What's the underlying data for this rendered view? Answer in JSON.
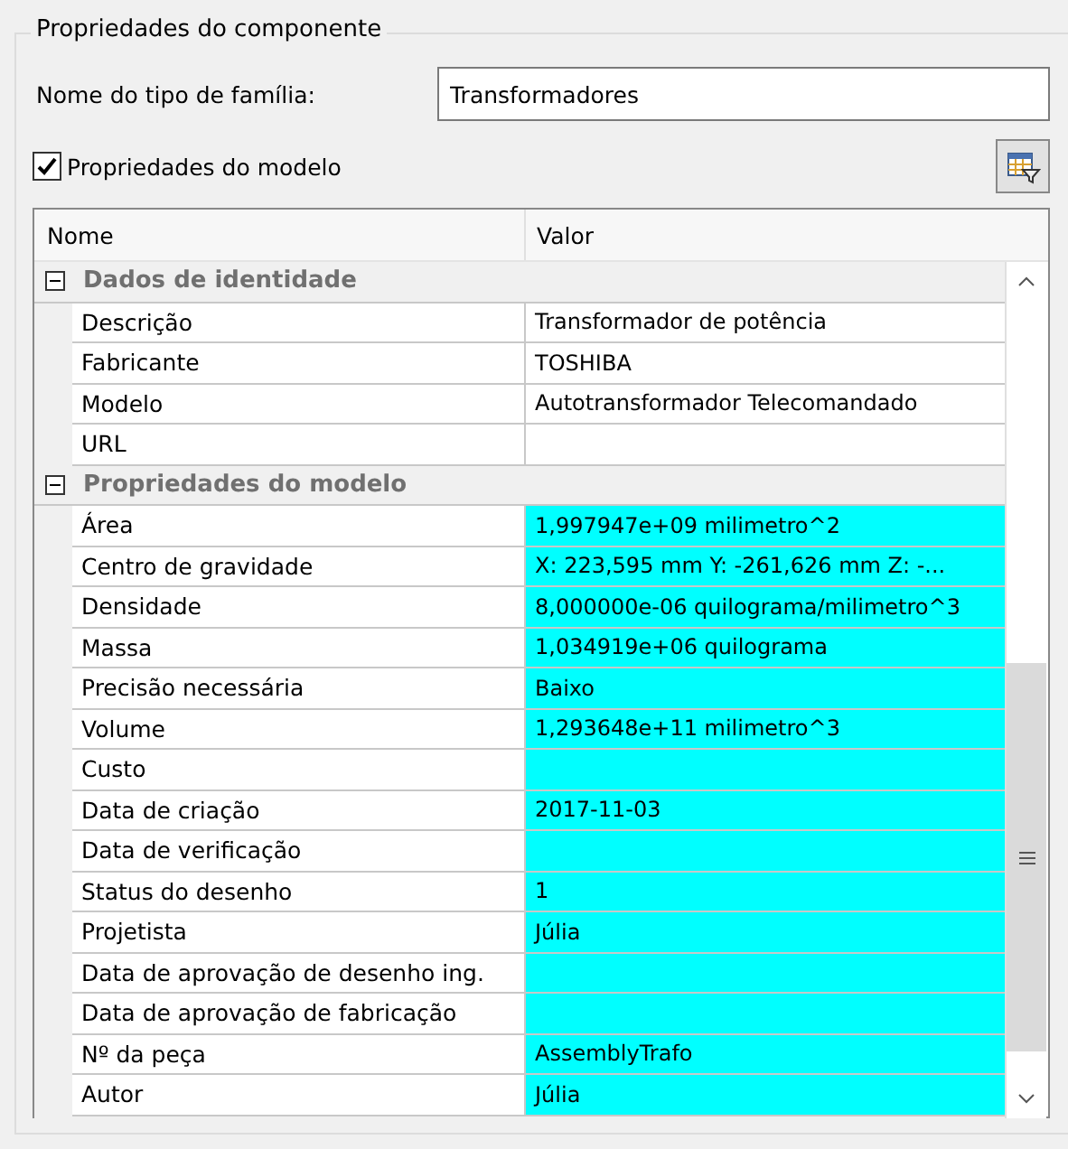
{
  "group_title": "Propriedades do componente",
  "family_label": "Nome do tipo de família:",
  "family_value": "Transformadores",
  "model_checkbox": {
    "label": "Propriedades do modelo",
    "checked": true
  },
  "table": {
    "columns": [
      "Nome",
      "Valor"
    ],
    "sections": [
      {
        "title": "Dados de identidade",
        "expanded": true,
        "rows": [
          {
            "name": "Descrição",
            "value": "Transformador de potência",
            "highlighted": false
          },
          {
            "name": "Fabricante",
            "value": "TOSHIBA",
            "highlighted": false
          },
          {
            "name": "Modelo",
            "value": "Autotransformador Telecomandado",
            "highlighted": false
          },
          {
            "name": "URL",
            "value": "",
            "highlighted": false
          }
        ]
      },
      {
        "title": "Propriedades do modelo",
        "expanded": true,
        "rows": [
          {
            "name": "Área",
            "value": "1,997947e+09 milimetro^2",
            "highlighted": true
          },
          {
            "name": "Centro de gravidade",
            "value": "X: 223,595 mm Y: -261,626 mm Z: -...",
            "highlighted": true
          },
          {
            "name": "Densidade",
            "value": "8,000000e-06 quilograma/milimetro^3",
            "highlighted": true
          },
          {
            "name": "Massa",
            "value": "1,034919e+06 quilograma",
            "highlighted": true
          },
          {
            "name": "Precisão necessária",
            "value": "Baixo",
            "highlighted": true
          },
          {
            "name": "Volume",
            "value": "1,293648e+11 milimetro^3",
            "highlighted": true
          },
          {
            "name": "Custo",
            "value": "",
            "highlighted": true
          },
          {
            "name": "Data de criação",
            "value": "2017-11-03",
            "highlighted": true
          },
          {
            "name": "Data de verificação",
            "value": "",
            "highlighted": true
          },
          {
            "name": "Status do desenho",
            "value": "1",
            "highlighted": true
          },
          {
            "name": "Projetista",
            "value": "Júlia",
            "highlighted": true
          },
          {
            "name": "Data de aprovação de desenho ing.",
            "value": "",
            "highlighted": true
          },
          {
            "name": "Data de aprovação de fabricação",
            "value": "",
            "highlighted": true
          },
          {
            "name": "Nº da peça",
            "value": "AssemblyTrafo",
            "highlighted": true
          },
          {
            "name": "Autor",
            "value": "Júlia",
            "highlighted": true
          }
        ]
      }
    ]
  }
}
